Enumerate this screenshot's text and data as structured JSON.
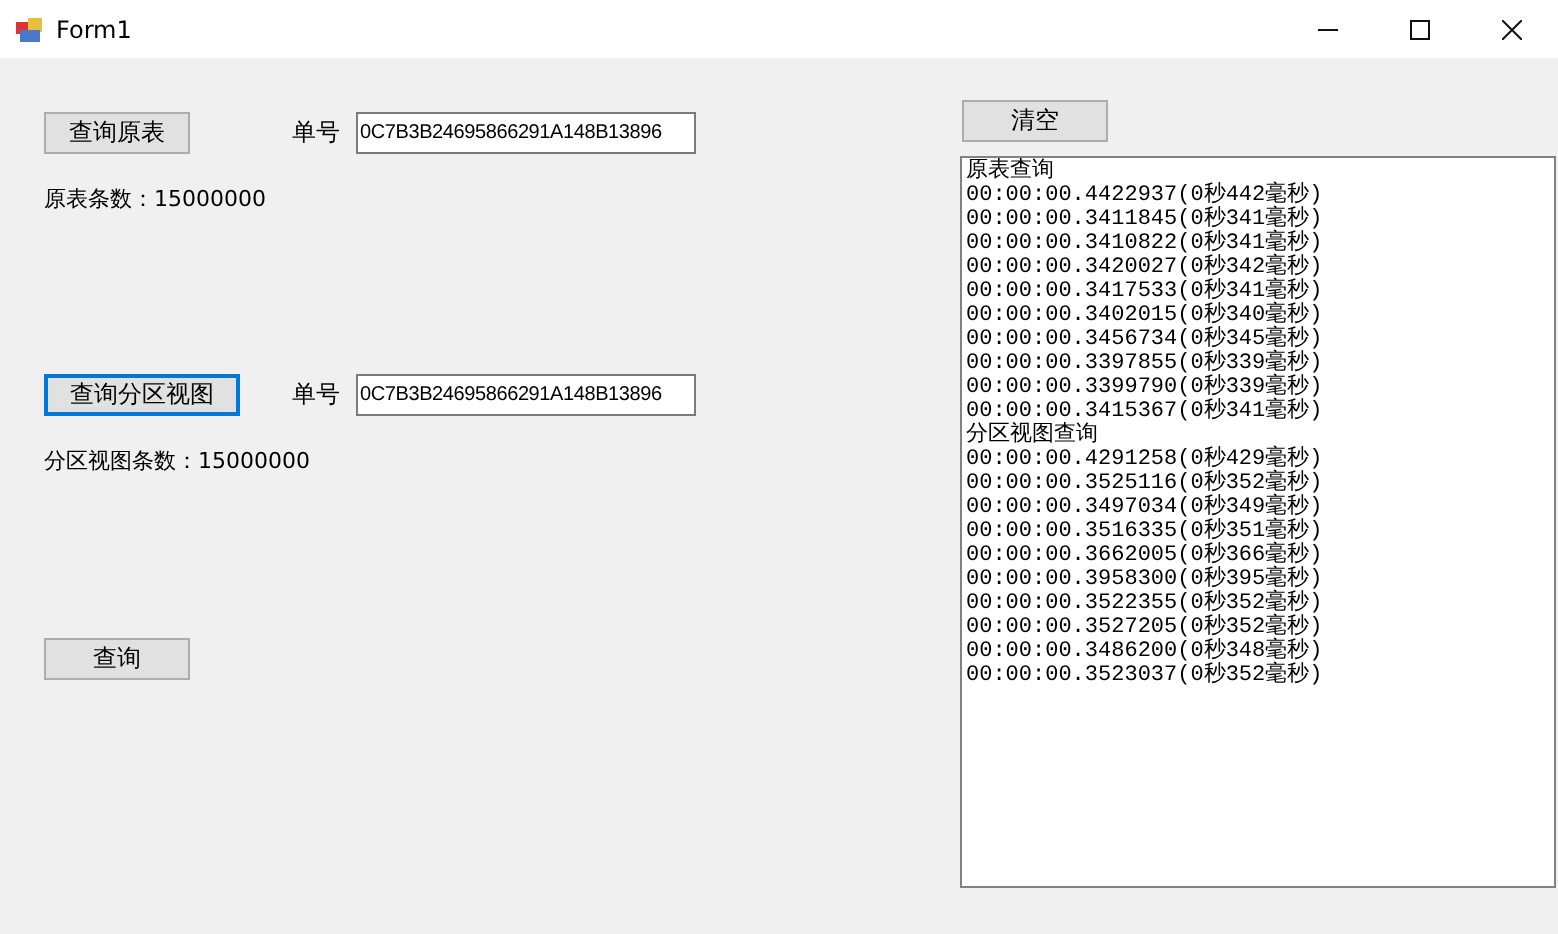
{
  "window": {
    "title": "Form1"
  },
  "sections": [
    {
      "button": {
        "label": "查询原表",
        "focused": false
      },
      "field": {
        "label": "单号",
        "value": "0C7B3B24695866291A148B13896"
      },
      "count": "原表条数：15000000"
    },
    {
      "button": {
        "label": "查询分区视图",
        "focused": true
      },
      "field": {
        "label": "单号",
        "value": "0C7B3B24695866291A148B13896"
      },
      "count": "分区视图条数：15000000"
    }
  ],
  "query_button": {
    "label": "查询",
    "focused": false
  },
  "clear_button": {
    "label": "清空",
    "focused": false
  },
  "log": {
    "lines": [
      "原表查询",
      "00:00:00.4422937(0秒442毫秒)",
      "00:00:00.3411845(0秒341毫秒)",
      "00:00:00.3410822(0秒341毫秒)",
      "00:00:00.3420027(0秒342毫秒)",
      "00:00:00.3417533(0秒341毫秒)",
      "00:00:00.3402015(0秒340毫秒)",
      "00:00:00.3456734(0秒345毫秒)",
      "00:00:00.3397855(0秒339毫秒)",
      "00:00:00.3399790(0秒339毫秒)",
      "00:00:00.3415367(0秒341毫秒)",
      "分区视图查询",
      "00:00:00.4291258(0秒429毫秒)",
      "00:00:00.3525116(0秒352毫秒)",
      "00:00:00.3497034(0秒349毫秒)",
      "00:00:00.3516335(0秒351毫秒)",
      "00:00:00.3662005(0秒366毫秒)",
      "00:00:00.3958300(0秒395毫秒)",
      "00:00:00.3522355(0秒352毫秒)",
      "00:00:00.3527205(0秒352毫秒)",
      "00:00:00.3486200(0秒348毫秒)",
      "00:00:00.3523037(0秒352毫秒)"
    ]
  }
}
